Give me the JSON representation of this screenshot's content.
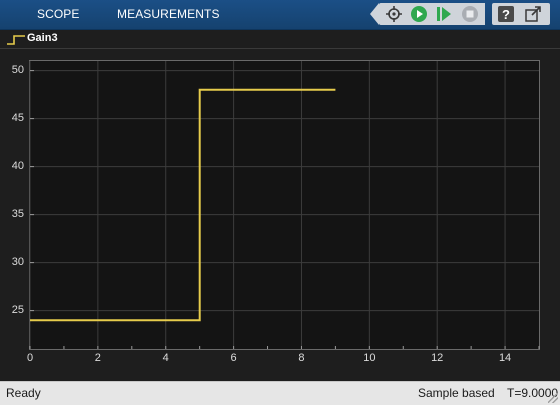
{
  "toolbar": {
    "tabs": [
      {
        "label": "SCOPE"
      },
      {
        "label": "MEASUREMENTS"
      }
    ],
    "buttons": [
      {
        "name": "signal-select-icon"
      },
      {
        "name": "run-icon"
      },
      {
        "name": "step-forward-icon"
      },
      {
        "name": "stop-icon"
      },
      {
        "name": "help-icon"
      },
      {
        "name": "undock-icon"
      }
    ]
  },
  "legend": {
    "series_name": "Gain3",
    "color": "#e6cc4c"
  },
  "chart_data": {
    "type": "line",
    "title": "",
    "xlabel": "",
    "ylabel": "",
    "xlim": [
      0,
      15
    ],
    "ylim": [
      21,
      51
    ],
    "xticks": [
      0,
      2,
      4,
      6,
      8,
      10,
      12,
      14
    ],
    "yticks": [
      25,
      30,
      35,
      40,
      45,
      50
    ],
    "grid": true,
    "background": "#141414",
    "series": [
      {
        "name": "Gain3",
        "color": "#e6cc4c",
        "step": true,
        "x": [
          0,
          5,
          5,
          9
        ],
        "y": [
          24,
          24,
          48,
          48
        ]
      }
    ]
  },
  "status": {
    "state": "Ready",
    "mode": "Sample based",
    "time": "T=9.0000"
  }
}
